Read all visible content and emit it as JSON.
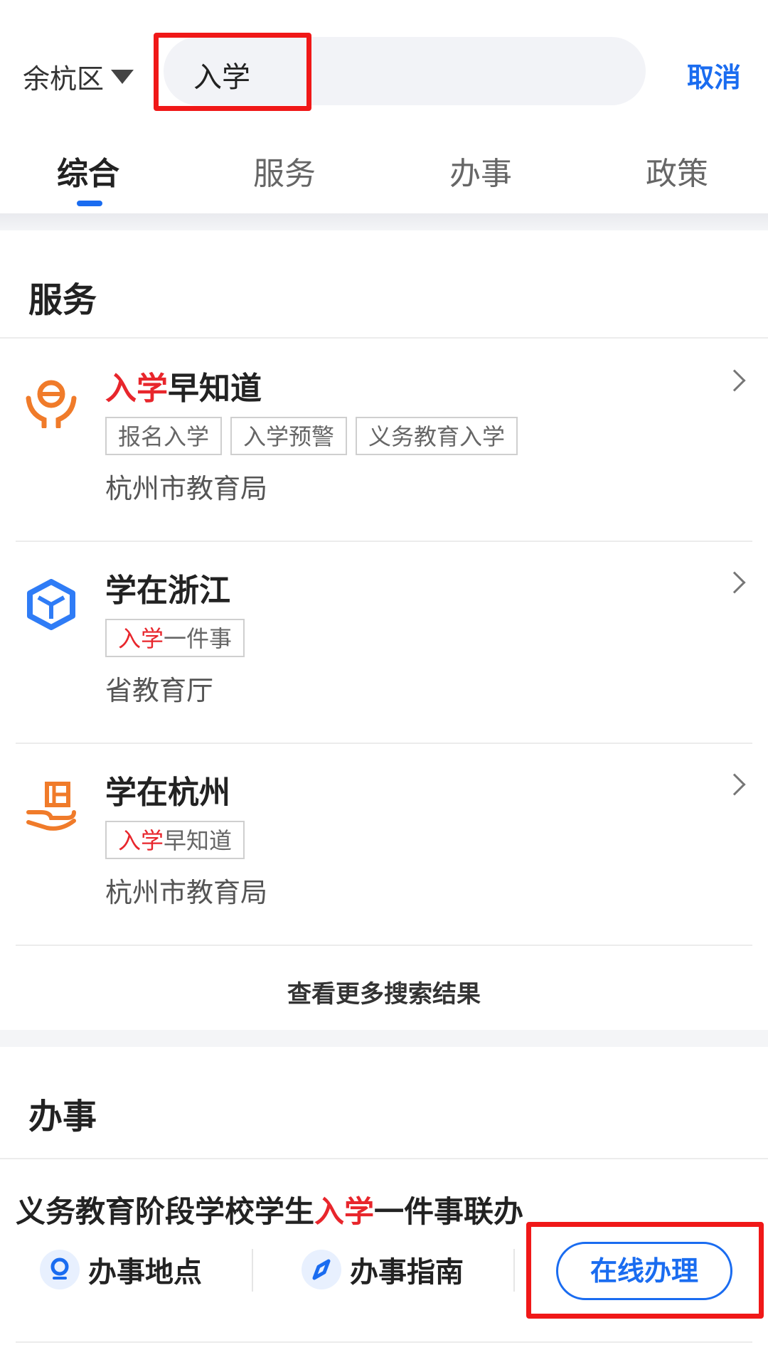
{
  "header": {
    "district": "余杭区",
    "search_query": "入学",
    "cancel_label": "取消"
  },
  "tabs": [
    {
      "label": "综合",
      "active": true
    },
    {
      "label": "服务",
      "active": false
    },
    {
      "label": "办事",
      "active": false
    },
    {
      "label": "政策",
      "active": false
    }
  ],
  "services": {
    "title": "服务",
    "items": [
      {
        "name_hl": "入学",
        "name_rest": "早知道",
        "icon": "hands-e-icon",
        "tags": [
          "报名入学",
          "入学预警",
          "义务教育入学"
        ],
        "dept": "杭州市教育局"
      },
      {
        "name_hl": "",
        "name_rest": "学在浙江",
        "icon": "cube-icon",
        "tag_hl": "入学",
        "tag_rest": "一件事",
        "dept": "省教育厅"
      },
      {
        "name_hl": "",
        "name_rest": "学在杭州",
        "icon": "hand-book-icon",
        "tag_hl": "入学",
        "tag_rest": "早知道",
        "dept": "杭州市教育局"
      }
    ],
    "more_label": "查看更多搜索结果"
  },
  "affairs": {
    "title": "办事",
    "item": {
      "title_pre": "义务教育阶段学校学生",
      "title_hl": "入学",
      "title_post": "一件事联办",
      "location_label": "办事地点",
      "guide_label": "办事指南",
      "online_label": "在线办理"
    }
  },
  "colors": {
    "accent": "#1a6cf0",
    "highlight": "#e8262c",
    "annotation_box": "#f01818"
  }
}
